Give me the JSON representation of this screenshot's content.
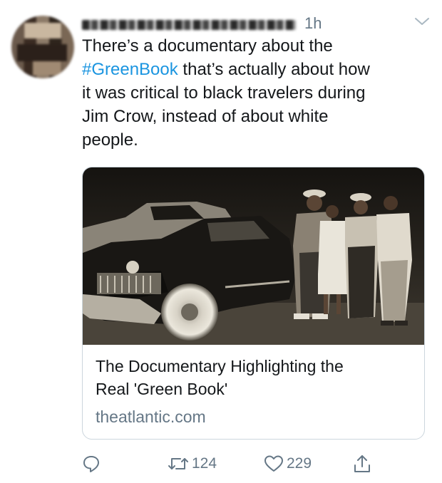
{
  "tweet": {
    "time": "1h",
    "text_lines": [
      {
        "before": "There’s a documentary about the",
        "hashtag": "",
        "after": ""
      },
      {
        "before": "",
        "hashtag": "#GreenBook",
        "after": " that’s actually about how"
      },
      {
        "before": "it was critical to black travelers during",
        "hashtag": "",
        "after": ""
      },
      {
        "before": "Jim Crow, instead of about white",
        "hashtag": "",
        "after": ""
      },
      {
        "before": "people.",
        "hashtag": "",
        "after": ""
      }
    ]
  },
  "card": {
    "title_line1": "The Documentary Highlighting the",
    "title_line2": "Real 'Green Book'",
    "domain": "theatlantic.com"
  },
  "actions": {
    "retweet_count": "124",
    "like_count": "229"
  },
  "icons": {
    "reply": "reply-icon",
    "retweet": "retweet-icon",
    "like": "heart-icon",
    "share": "share-icon",
    "menu": "chevron-down-icon"
  },
  "colors": {
    "hashtag": "#1b95e0",
    "muted": "#657786",
    "text": "#14171a",
    "border": "#ccd6dd"
  }
}
